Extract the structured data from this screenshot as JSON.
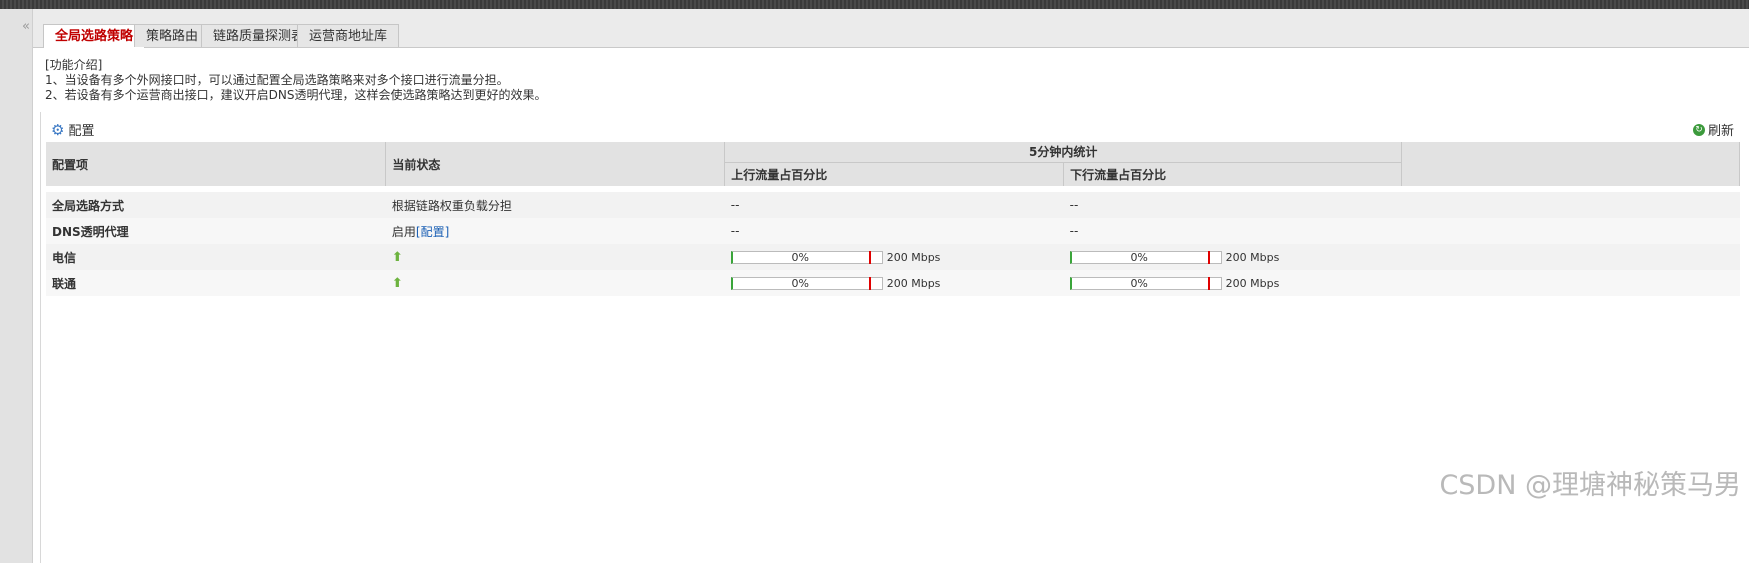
{
  "tabs": [
    {
      "label": "全局选路策略",
      "active": true
    },
    {
      "label": "策略路由",
      "active": false
    },
    {
      "label": "链路质量探测表",
      "active": false
    },
    {
      "label": "运营商地址库",
      "active": false
    }
  ],
  "intro": {
    "title": "[功能介绍]",
    "line1": "1、当设备有多个外网接口时，可以通过配置全局选路策略来对多个接口进行流量分担。",
    "line2": "2、若设备有多个运营商出接口，建议开启DNS透明代理，这样会使选路策略达到更好的效果。"
  },
  "toolbar": {
    "config_label": "配置",
    "refresh_label": "刷新"
  },
  "table": {
    "headers": {
      "item": "配置项",
      "status": "当前状态",
      "stats_group": "5分钟内统计",
      "upstream": "上行流量占百分比",
      "downstream": "下行流量占百分比"
    },
    "rows": [
      {
        "name": "全局选路方式",
        "status": "根据链路权重负载分担",
        "up": "--",
        "down": "--"
      },
      {
        "name": "DNS透明代理",
        "status": "启用",
        "status_link": "[配置]",
        "up": "--",
        "down": "--"
      },
      {
        "name": "电信",
        "status_icon": "up-arrow-icon",
        "up": {
          "percent": "0%",
          "fraction": 0,
          "bandwidth": "200 Mbps"
        },
        "down": {
          "percent": "0%",
          "fraction": 0,
          "bandwidth": "200 Mbps"
        }
      },
      {
        "name": "联通",
        "status_icon": "up-arrow-icon",
        "up": {
          "percent": "0%",
          "fraction": 0,
          "bandwidth": "200 Mbps"
        },
        "down": {
          "percent": "0%",
          "fraction": 0,
          "bandwidth": "200 Mbps"
        }
      }
    ]
  },
  "watermark": "CSDN @理塘神秘策马男",
  "colors": {
    "active_tab": "#c00000",
    "link": "#1a5fb4",
    "bar_start": "#3aa53a",
    "bar_limit": "#e00000"
  }
}
